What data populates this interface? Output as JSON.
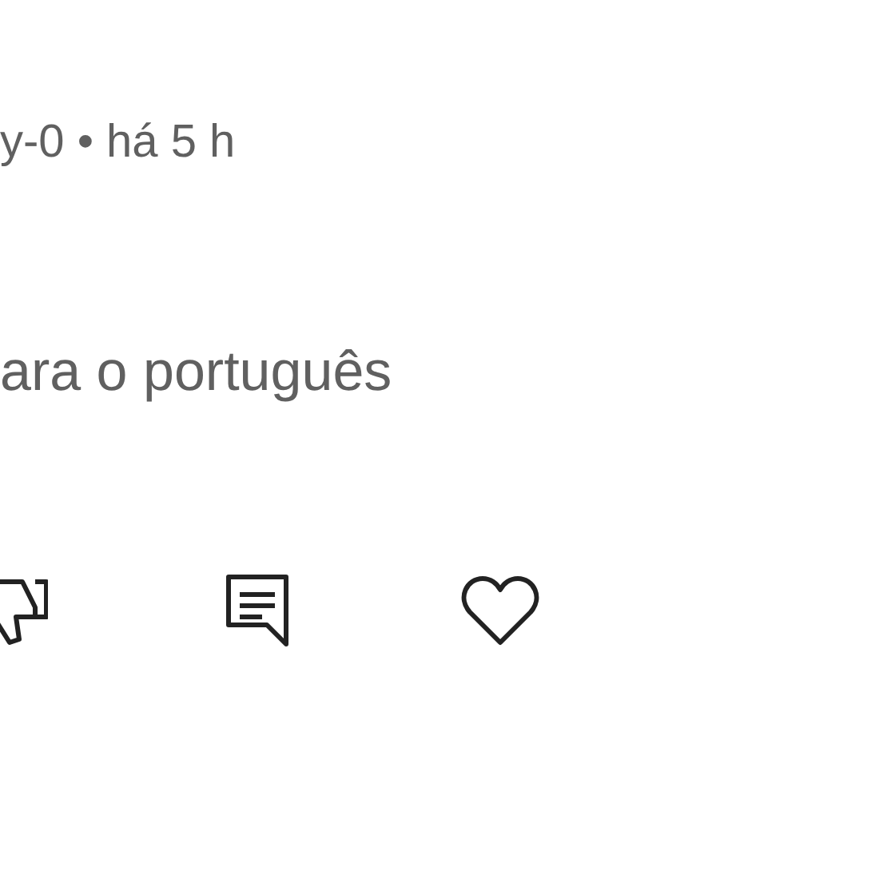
{
  "comment": {
    "meta": "y-0 • há 5 h",
    "translate_link": "ara o português"
  },
  "actions": [
    {
      "kind": "dislike"
    },
    {
      "kind": "reply"
    },
    {
      "kind": "like"
    }
  ]
}
